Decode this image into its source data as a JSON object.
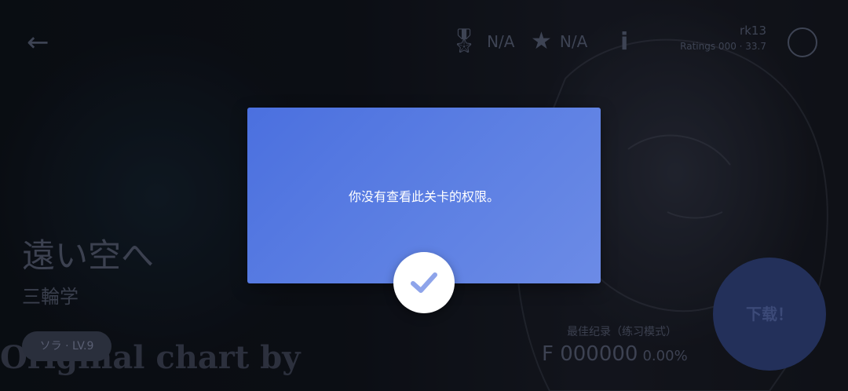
{
  "header": {
    "back_icon": "arrow-left-icon",
    "medal": {
      "icon": "medal-icon",
      "value": "N/A"
    },
    "star": {
      "icon": "star-icon",
      "value": "N/A"
    },
    "info_icon": "info-icon",
    "user_name": "rk13",
    "user_sub": "Ratings 000 · 33.7",
    "settings_icon": "circle-icon"
  },
  "level": {
    "title": "遠い空へ",
    "artist": "三輪学",
    "difficulty_badge": "ソラ · LV.9",
    "watermark": "Original chart by"
  },
  "best_record": {
    "label": "最佳纪录（练习模式）",
    "score": "F 000000",
    "accuracy": "0.00%"
  },
  "download": {
    "label": "下载！"
  },
  "dialog": {
    "message": "你没有查看此关卡的权限。",
    "confirm_icon": "checkmark-icon",
    "accent": "#4b70df"
  }
}
